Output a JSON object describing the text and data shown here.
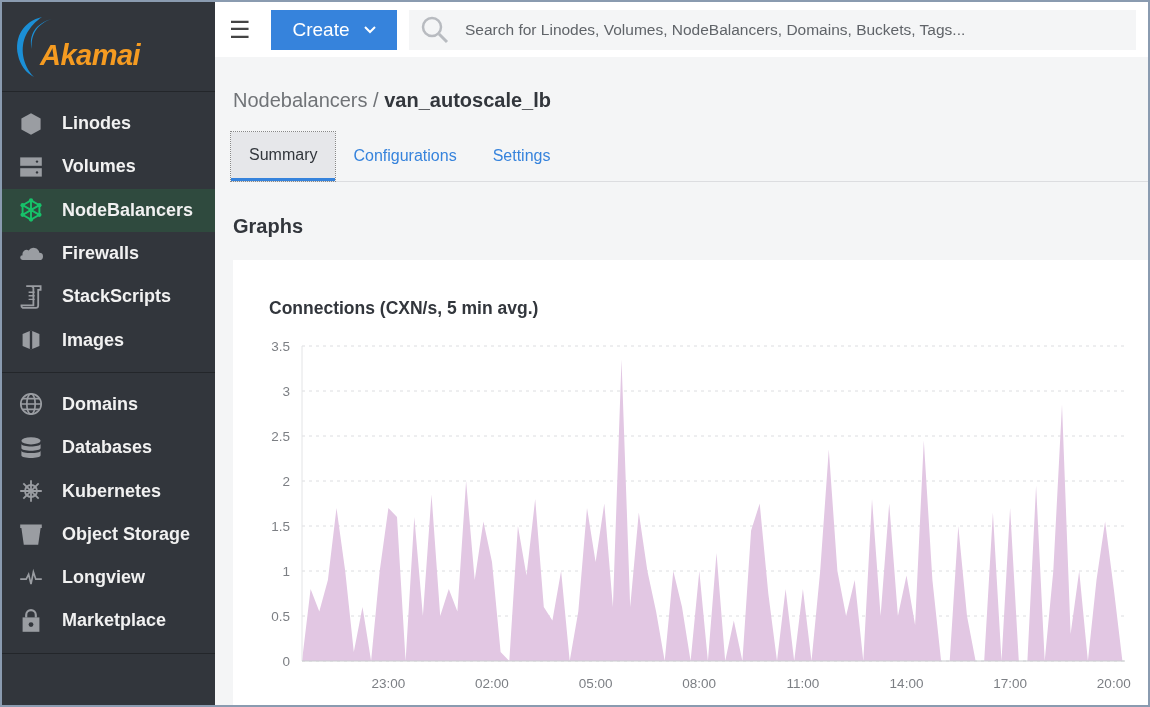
{
  "logo": {
    "text": "Akamai"
  },
  "sidebar": {
    "groups": [
      {
        "items": [
          {
            "label": "Linodes",
            "selected": false
          },
          {
            "label": "Volumes",
            "selected": false
          },
          {
            "label": "NodeBalancers",
            "selected": true
          },
          {
            "label": "Firewalls",
            "selected": false
          },
          {
            "label": "StackScripts",
            "selected": false
          },
          {
            "label": "Images",
            "selected": false
          }
        ]
      },
      {
        "items": [
          {
            "label": "Domains",
            "selected": false
          },
          {
            "label": "Databases",
            "selected": false
          },
          {
            "label": "Kubernetes",
            "selected": false
          },
          {
            "label": "Object Storage",
            "selected": false
          },
          {
            "label": "Longview",
            "selected": false
          },
          {
            "label": "Marketplace",
            "selected": false
          }
        ]
      }
    ]
  },
  "topbar": {
    "menu_icon": "☰",
    "create_button": "Create",
    "search": {
      "placeholder": "Search for Linodes, Volumes, NodeBalancers, Domains, Buckets, Tags..."
    }
  },
  "breadcrumb": {
    "parent": "Nodebalancers",
    "separator": "/",
    "current": "van_autoscale_lb"
  },
  "tabs": [
    {
      "label": "Summary",
      "selected": true
    },
    {
      "label": "Configurations",
      "selected": false
    },
    {
      "label": "Settings",
      "selected": false
    }
  ],
  "section_title": "Graphs",
  "graph": {
    "title": "Connections (CXN/s, 5 min avg.)",
    "chart_data": {
      "type": "area",
      "categories": [
        null,
        null,
        null,
        null,
        null,
        null,
        null,
        null,
        null,
        null,
        "23:00",
        null,
        null,
        null,
        null,
        null,
        null,
        null,
        null,
        null,
        null,
        null,
        "02:00",
        null,
        null,
        null,
        null,
        null,
        null,
        null,
        null,
        null,
        null,
        null,
        "05:00",
        null,
        null,
        null,
        null,
        null,
        null,
        null,
        null,
        null,
        null,
        null,
        "08:00",
        null,
        null,
        null,
        null,
        null,
        null,
        null,
        null,
        null,
        null,
        null,
        "11:00",
        null,
        null,
        null,
        null,
        null,
        null,
        null,
        null,
        null,
        null,
        null,
        "14:00",
        null,
        null,
        null,
        null,
        null,
        null,
        null,
        null,
        null,
        null,
        null,
        "17:00",
        null,
        null,
        null,
        null,
        null,
        null,
        null,
        null,
        null,
        null,
        null,
        "20:00",
        null
      ],
      "series": [
        {
          "color": "#e2c7e3",
          "values": [
            0,
            0.8,
            0.55,
            0.9,
            1.7,
            1.0,
            0.1,
            0.6,
            0,
            1.0,
            1.7,
            1.6,
            0,
            1.6,
            0.5,
            1.85,
            0.5,
            0.8,
            0.55,
            2.0,
            0.9,
            1.55,
            1.1,
            0.1,
            0,
            1.5,
            0.95,
            1.8,
            0.6,
            0.45,
            1.0,
            0,
            0.55,
            1.7,
            1.1,
            1.75,
            0.6,
            3.35,
            0.6,
            1.65,
            1.0,
            0.55,
            0,
            1.0,
            0.6,
            0,
            1.0,
            0,
            1.2,
            0,
            0.45,
            0,
            1.45,
            1.75,
            0.75,
            0,
            0.8,
            0,
            0.8,
            0,
            1.0,
            2.35,
            1.0,
            0.5,
            0.9,
            0,
            1.8,
            0.5,
            1.75,
            0.5,
            0.95,
            0.4,
            2.45,
            0.9,
            0,
            0,
            1.5,
            0.5,
            0,
            0,
            1.65,
            0,
            1.7,
            0,
            0,
            1.95,
            0,
            1.0,
            2.85,
            0.3,
            1.0,
            0,
            0.9,
            1.55,
            0.8,
            0
          ]
        }
      ],
      "ylim": [
        0,
        3.5
      ],
      "grid": true,
      "yticks": [
        0,
        0.5,
        1,
        1.5,
        2,
        2.5,
        3,
        3.5
      ]
    }
  }
}
